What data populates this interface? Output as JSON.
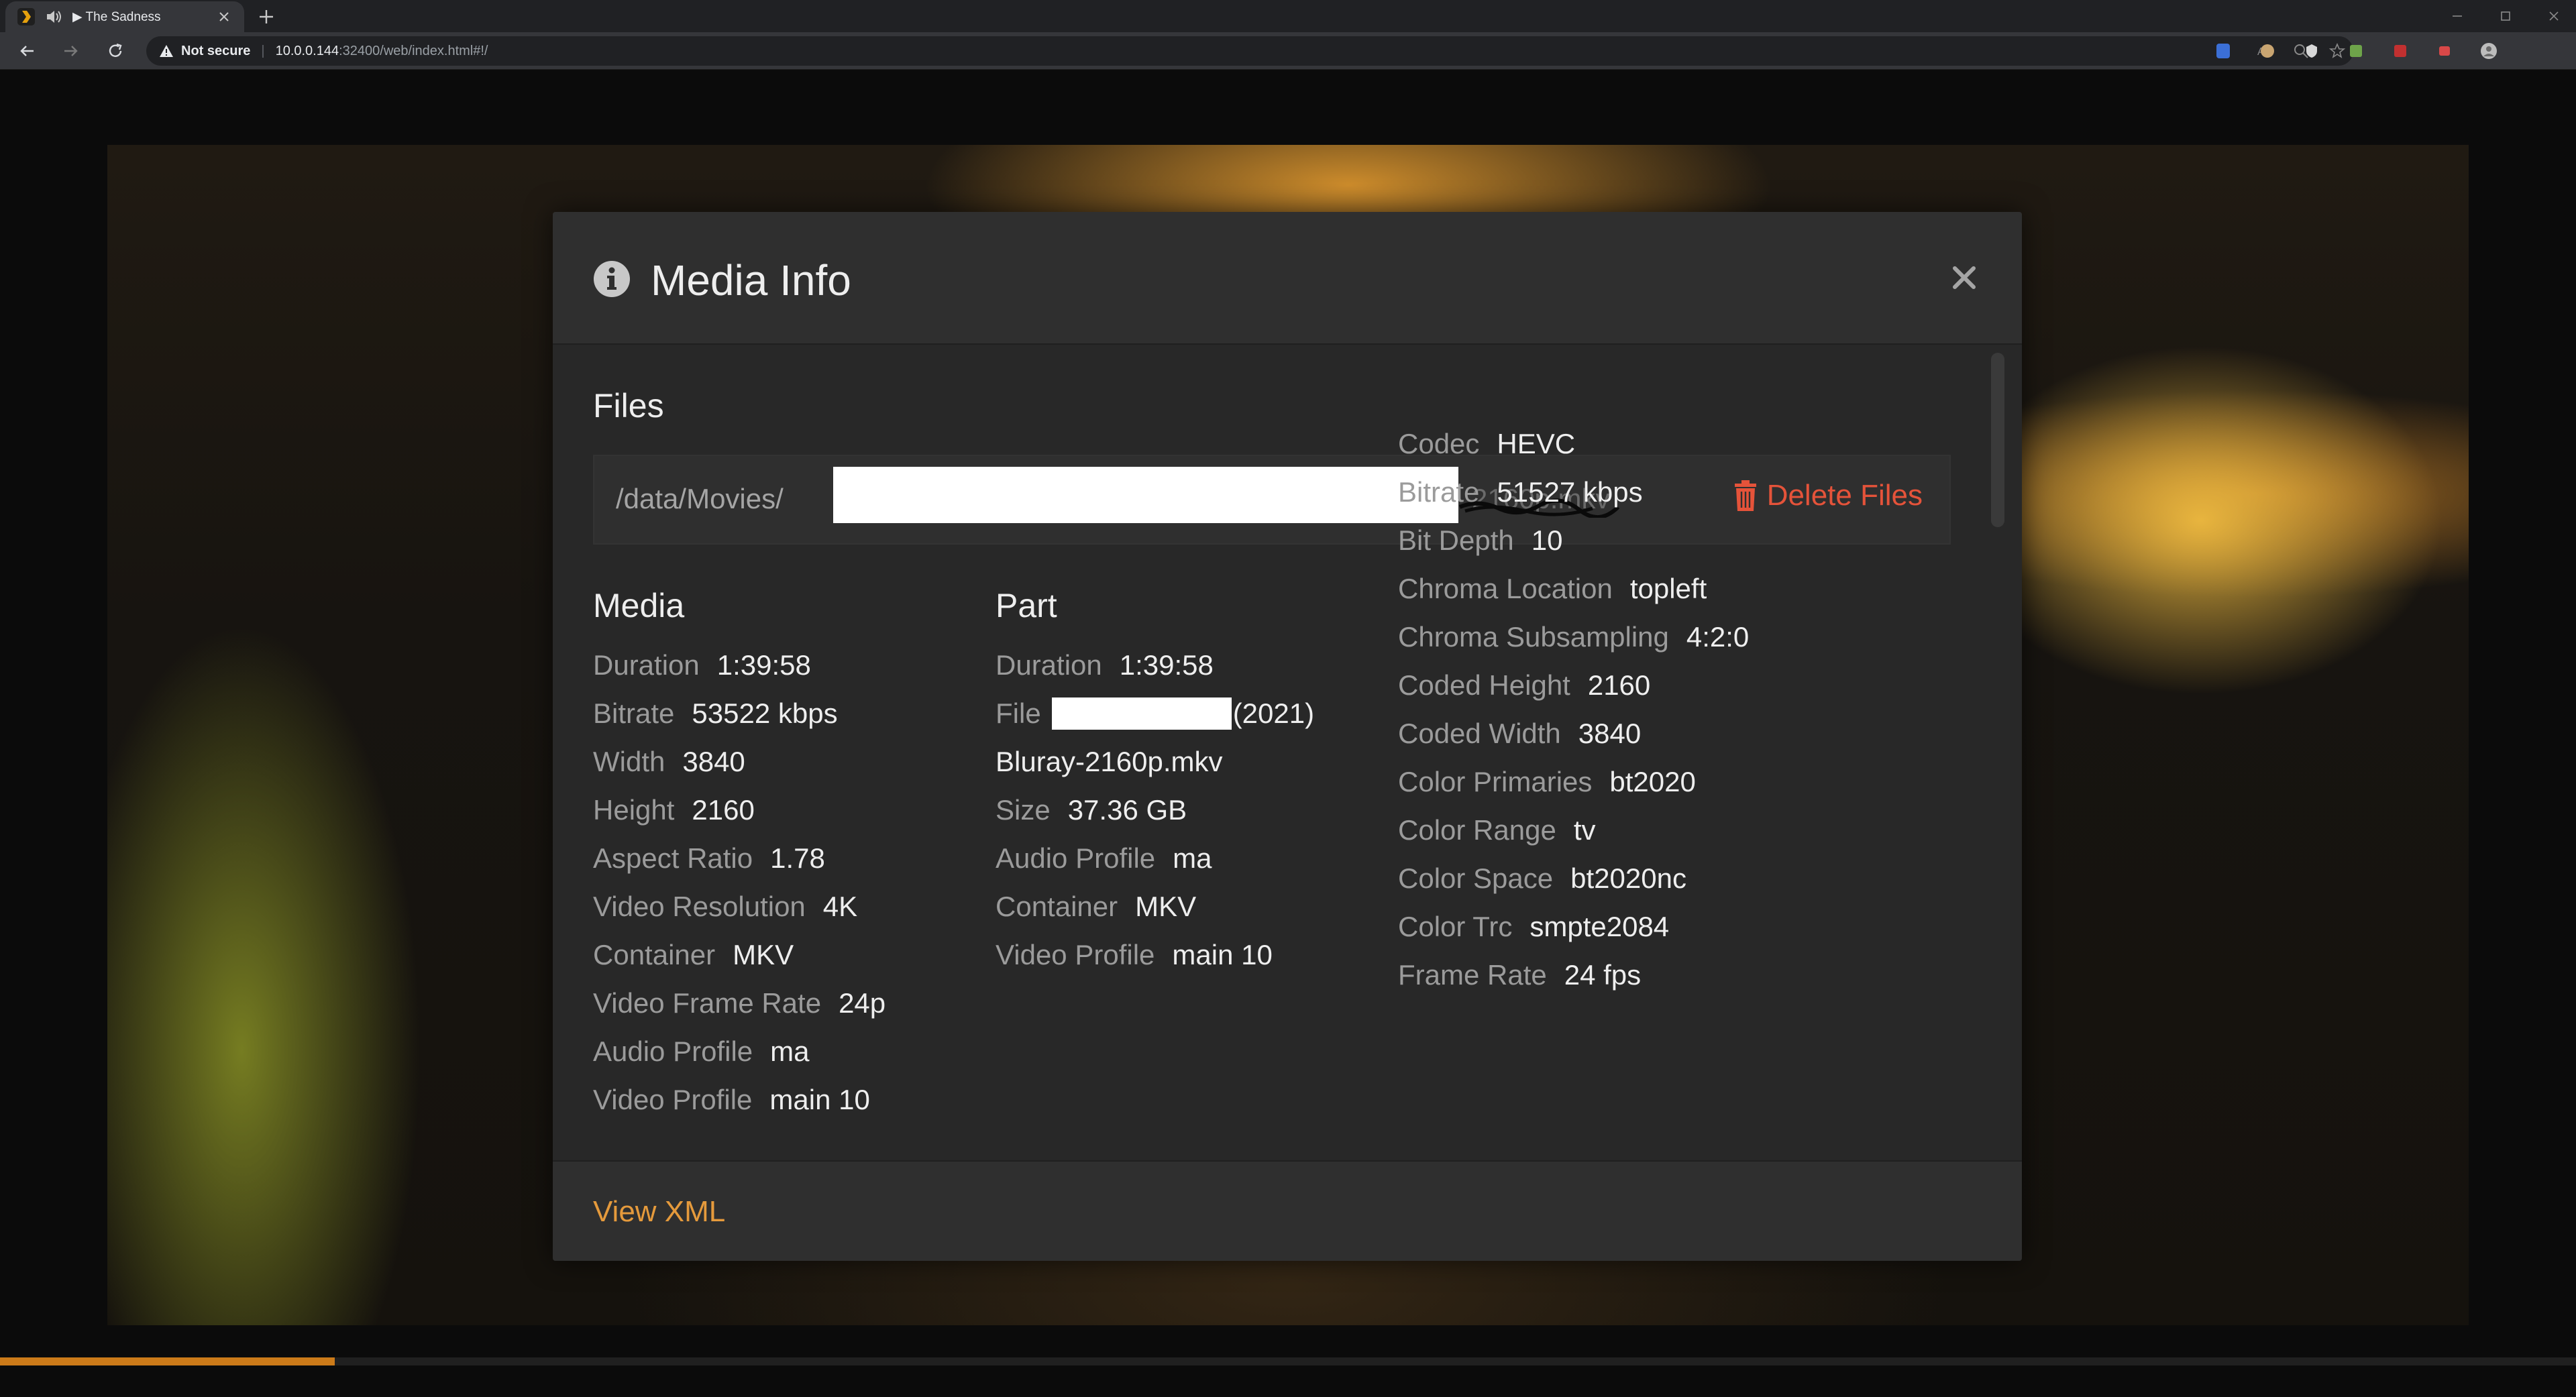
{
  "browser": {
    "tab_title": "▶ The Sadness",
    "security_label": "Not secure",
    "url_host": "10.0.0.144",
    "url_path": ":32400/web/index.html#!/"
  },
  "player": {
    "progress_fraction": 0.13
  },
  "modal": {
    "title": "Media Info",
    "files_heading": "Files",
    "file_path_prefix": "/data/Movies/",
    "file_path_suffix_visible": "2160p.mkv",
    "delete_files_label": "Delete Files",
    "view_xml_label": "View XML",
    "media": {
      "heading": "Media",
      "rows": [
        {
          "label": "Duration",
          "value": "1:39:58"
        },
        {
          "label": "Bitrate",
          "value": "53522 kbps"
        },
        {
          "label": "Width",
          "value": "3840"
        },
        {
          "label": "Height",
          "value": "2160"
        },
        {
          "label": "Aspect Ratio",
          "value": "1.78"
        },
        {
          "label": "Video Resolution",
          "value": "4K"
        },
        {
          "label": "Container",
          "value": "MKV"
        },
        {
          "label": "Video Frame Rate",
          "value": "24p"
        },
        {
          "label": "Audio Profile",
          "value": "ma"
        },
        {
          "label": "Video Profile",
          "value": "main 10"
        }
      ]
    },
    "part": {
      "heading": "Part",
      "duration_label": "Duration",
      "duration_value": "1:39:58",
      "file_label": "File",
      "file_value_visible": "(2021)",
      "file_value_line2": "Bluray-2160p.mkv",
      "rows": [
        {
          "label": "Size",
          "value": "37.36 GB"
        },
        {
          "label": "Audio Profile",
          "value": "ma"
        },
        {
          "label": "Container",
          "value": "MKV"
        },
        {
          "label": "Video Profile",
          "value": "main 10"
        }
      ]
    },
    "stream": {
      "rows": [
        {
          "label": "Codec",
          "value": "HEVC"
        },
        {
          "label": "Bitrate",
          "value": "51527 kbps"
        },
        {
          "label": "Bit Depth",
          "value": "10"
        },
        {
          "label": "Chroma Location",
          "value": "topleft"
        },
        {
          "label": "Chroma Subsampling",
          "value": "4:2:0"
        },
        {
          "label": "Coded Height",
          "value": "2160"
        },
        {
          "label": "Coded Width",
          "value": "3840"
        },
        {
          "label": "Color Primaries",
          "value": "bt2020"
        },
        {
          "label": "Color Range",
          "value": "tv"
        },
        {
          "label": "Color Space",
          "value": "bt2020nc"
        },
        {
          "label": "Color Trc",
          "value": "smpte2084"
        },
        {
          "label": "Frame Rate",
          "value": "24 fps"
        }
      ]
    }
  },
  "colors": {
    "accent_orange": "#e59a3c",
    "delete_red": "#e5533a",
    "progress_orange": "#cc7b19"
  },
  "icons": {
    "info": "info-circle-icon",
    "close": "close-icon",
    "trash": "trash-icon"
  }
}
